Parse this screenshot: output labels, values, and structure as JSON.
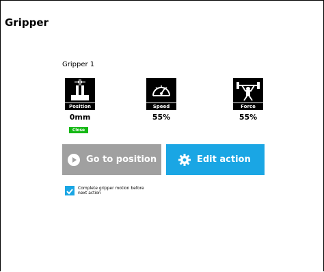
{
  "page": {
    "title": "Gripper"
  },
  "gripper": {
    "name": "Gripper 1",
    "metrics": [
      {
        "label": "Position",
        "value": "0mm",
        "icon": "gripper-jaws-icon"
      },
      {
        "label": "Speed",
        "value": "55%",
        "icon": "speedometer-icon"
      },
      {
        "label": "Force",
        "value": "55%",
        "icon": "weightlifter-icon"
      }
    ],
    "status_badge": "Close"
  },
  "buttons": {
    "go_to_position": {
      "label": "Go to position",
      "icon": "play-circle-icon",
      "color": "#a0a0a0"
    },
    "edit_action": {
      "label": "Edit action",
      "icon": "gear-icon",
      "color": "#1aa6e4"
    }
  },
  "option": {
    "label": "Complete gripper motion before next action",
    "checked": true
  }
}
